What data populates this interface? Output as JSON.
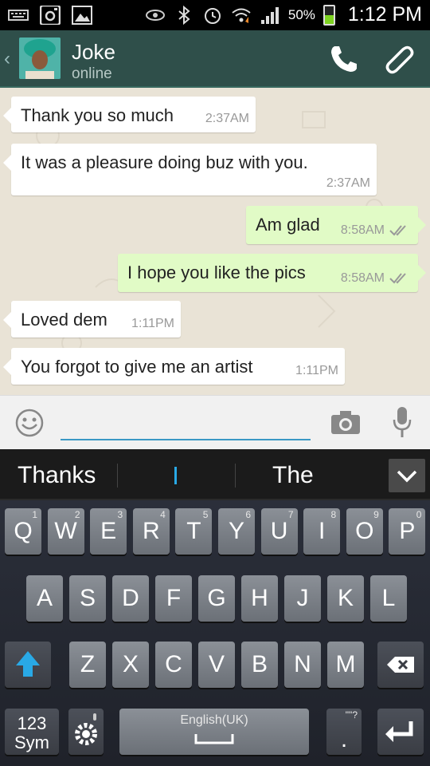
{
  "status_bar": {
    "battery": "50%",
    "time": "1:12 PM"
  },
  "header": {
    "contact_name": "Joke",
    "contact_status": "online"
  },
  "messages": [
    {
      "direction": "in",
      "text": "Thank you so much",
      "time": "2:37AM"
    },
    {
      "direction": "in",
      "text": "It was a pleasure doing buz with you.",
      "time": "2:37AM"
    },
    {
      "direction": "out",
      "text": "Am glad",
      "time": "8:58AM"
    },
    {
      "direction": "out",
      "text": "I hope you like the pics",
      "time": "8:58AM"
    },
    {
      "direction": "in",
      "text": "Loved dem",
      "time": "1:11PM"
    },
    {
      "direction": "in",
      "text": "You forgot to give me an artist",
      "time": "1:11PM"
    }
  ],
  "input": {
    "value": "",
    "placeholder": ""
  },
  "suggestions": {
    "left": "Thanks",
    "middle": "I",
    "right": "The"
  },
  "keyboard": {
    "row1": [
      {
        "label": "Q",
        "hint": "1"
      },
      {
        "label": "W",
        "hint": "2"
      },
      {
        "label": "E",
        "hint": "3"
      },
      {
        "label": "R",
        "hint": "4"
      },
      {
        "label": "T",
        "hint": "5"
      },
      {
        "label": "Y",
        "hint": "6"
      },
      {
        "label": "U",
        "hint": "7"
      },
      {
        "label": "I",
        "hint": "8"
      },
      {
        "label": "O",
        "hint": "9"
      },
      {
        "label": "P",
        "hint": "0"
      }
    ],
    "row2": [
      "A",
      "S",
      "D",
      "F",
      "G",
      "H",
      "J",
      "K",
      "L"
    ],
    "row3": [
      "Z",
      "X",
      "C",
      "V",
      "B",
      "N",
      "M"
    ],
    "sym_label_1": "123",
    "sym_label_2": "Sym",
    "space_label": "English(UK)",
    "period_label": ".",
    "period_hint": "\"\"?"
  },
  "colors": {
    "header_bg": "#2f4f4a",
    "chat_bg": "#e9e3d6",
    "outgoing_bubble": "#e1fbc6",
    "incoming_bubble": "#ffffff",
    "accent_blue": "#29a9e6"
  }
}
